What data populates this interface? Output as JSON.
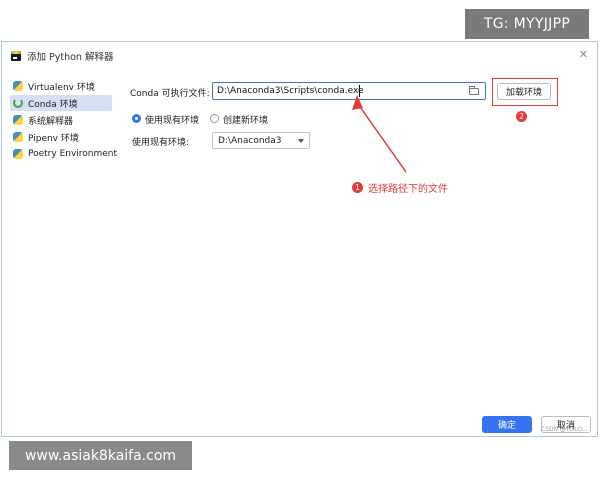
{
  "watermarks": {
    "top_right": "TG: MYYJJPP",
    "bottom_left": "www.asiak8kaifa.com",
    "csdn": "CSDN @YOLO..."
  },
  "dialog": {
    "title": "添加 Python 解释器",
    "close_icon": "close-icon"
  },
  "sidebar": {
    "items": [
      {
        "label": "Virtualenv 环境",
        "icon": "python-icon",
        "selected": false
      },
      {
        "label": "Conda 环境",
        "icon": "conda-icon",
        "selected": true
      },
      {
        "label": "系统解释器",
        "icon": "python-icon",
        "selected": false
      },
      {
        "label": "Pipenv 环境",
        "icon": "python-icon",
        "selected": false
      },
      {
        "label": "Poetry Environment",
        "icon": "python-icon",
        "selected": false
      }
    ]
  },
  "main": {
    "exe_label": "Conda 可执行文件:",
    "exe_path": "D:\\Anaconda3\\Scripts\\conda.exe",
    "load_button": "加载环境",
    "radio_existing": "使用现有环境",
    "radio_new": "创建新环境",
    "env_label": "使用现有环境:",
    "env_selected": "D:\\Anaconda3"
  },
  "annotations": {
    "step1_number": "1",
    "step1_text": "选择路径下的文件",
    "step2_number": "2",
    "color": "#e03c3c"
  },
  "footer": {
    "ok": "确定",
    "cancel": "取消"
  },
  "colors": {
    "accent": "#3574f0",
    "selected_bg": "#d5e0f5"
  }
}
